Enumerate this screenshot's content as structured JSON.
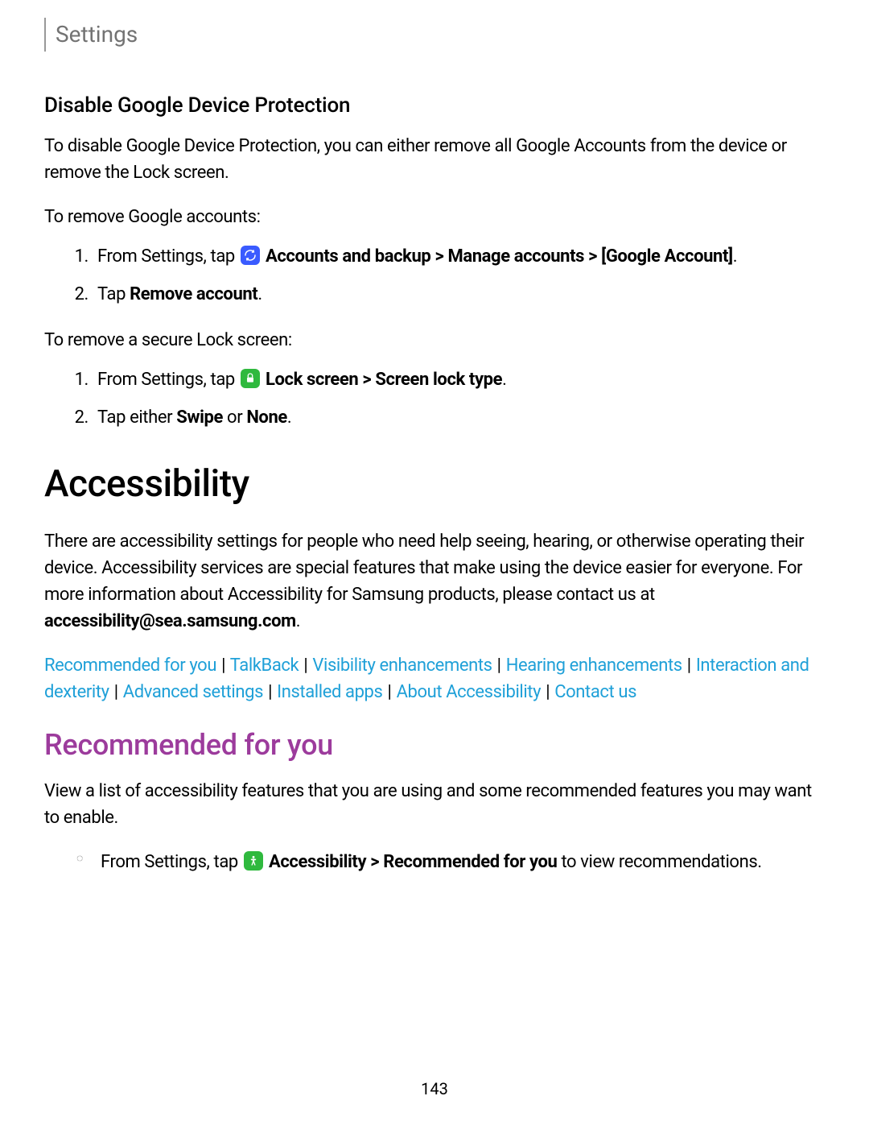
{
  "header": {
    "title": "Settings"
  },
  "section_disable": {
    "heading": "Disable Google Device Protection",
    "intro": "To disable Google Device Protection, you can either remove all Google Accounts from the device or remove the Lock screen.",
    "remove_accounts_intro": "To remove Google accounts:",
    "step1_prefix": "From Settings, tap ",
    "step1_bold_after_icon": "Accounts and backup > Manage accounts > [Google Account]",
    "step1_suffix": ".",
    "step2_prefix": "Tap ",
    "step2_bold": "Remove account",
    "step2_suffix": ".",
    "remove_lock_intro": "To remove a secure Lock screen:",
    "lock_step1_prefix": "From Settings, tap ",
    "lock_step1_bold_after_icon": "Lock screen > Screen lock type",
    "lock_step1_suffix": ".",
    "lock_step2_prefix": "Tap either ",
    "lock_step2_bold1": "Swipe",
    "lock_step2_mid": " or ",
    "lock_step2_bold2": "None",
    "lock_step2_suffix": "."
  },
  "accessibility": {
    "heading": "Accessibility",
    "para_prefix": "There are accessibility settings for people who need help seeing, hearing, or otherwise operating their device. Accessibility services are special features that make using the device easier for everyone. For more information about Accessibility for Samsung products, please contact us at ",
    "email_bold": "accessibility@sea.samsung.com",
    "para_suffix": ".",
    "links": {
      "recommended": "Recommended for you",
      "talkback": "TalkBack",
      "visibility": "Visibility enhancements",
      "hearing": "Hearing enhancements",
      "interaction": "Interaction and dexterity",
      "advanced": "Advanced settings",
      "installed": "Installed apps",
      "about": "About Accessibility",
      "contact": "Contact us"
    },
    "sep": "|"
  },
  "recommended": {
    "heading": "Recommended for you",
    "intro": "View a list of accessibility features that you are using and some recommended features you may want to enable.",
    "step_prefix": "From Settings, tap ",
    "step_bold_after_icon": "Accessibility > Recommended for you",
    "step_mid": " to view recommendations."
  },
  "page_number": "143"
}
